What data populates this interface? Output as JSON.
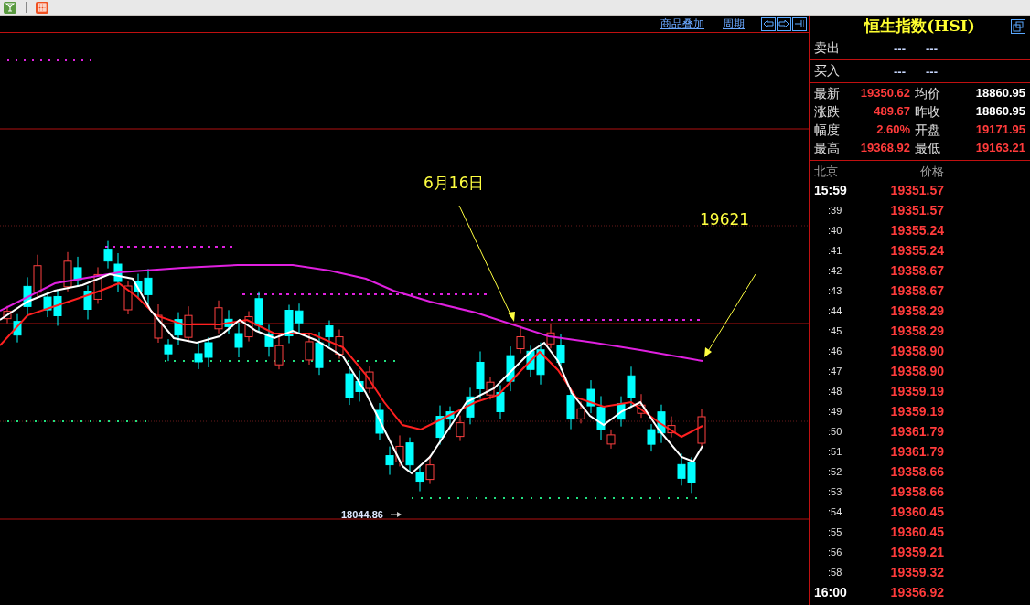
{
  "chart": {
    "links": [
      "商品叠加",
      "周期"
    ],
    "annotations": [
      {
        "text": "6月16日"
      },
      {
        "text": "19621"
      }
    ],
    "low_label": "18044.86"
  },
  "quote": {
    "title": "恒生指数(HSI)",
    "sell": {
      "label": "卖出",
      "values": [
        "---",
        "---"
      ]
    },
    "buy": {
      "label": "买入",
      "values": [
        "---",
        "---"
      ]
    },
    "stats": [
      {
        "label": "最新",
        "value": "19350.62",
        "color": "#ff3b3b"
      },
      {
        "label": "均价",
        "value": "18860.95",
        "color": "#ffffff"
      },
      {
        "label": "涨跌",
        "value": "489.67",
        "color": "#ff3b3b"
      },
      {
        "label": "昨收",
        "value": "18860.95",
        "color": "#ffffff"
      },
      {
        "label": "幅度",
        "value": "2.60%",
        "color": "#ff3b3b"
      },
      {
        "label": "开盘",
        "value": "19171.95",
        "color": "#ff3b3b"
      },
      {
        "label": "最高",
        "value": "19368.92",
        "color": "#ff3b3b"
      },
      {
        "label": "最低",
        "value": "19163.21",
        "color": "#ff3b3b"
      }
    ]
  },
  "ticks": {
    "headers": [
      "北京",
      "价格"
    ],
    "rows": [
      {
        "time": "15:59",
        "price": "19351.57",
        "kind": "hour"
      },
      {
        "time": ":39",
        "price": "19351.57",
        "kind": "minute"
      },
      {
        "time": ":40",
        "price": "19355.24",
        "kind": "minute"
      },
      {
        "time": ":41",
        "price": "19355.24",
        "kind": "minute"
      },
      {
        "time": ":42",
        "price": "19358.67",
        "kind": "minute"
      },
      {
        "time": ":43",
        "price": "19358.67",
        "kind": "minute"
      },
      {
        "time": ":44",
        "price": "19358.29",
        "kind": "minute"
      },
      {
        "time": ":45",
        "price": "19358.29",
        "kind": "minute"
      },
      {
        "time": ":46",
        "price": "19358.90",
        "kind": "minute"
      },
      {
        "time": ":47",
        "price": "19358.90",
        "kind": "minute"
      },
      {
        "time": ":48",
        "price": "19359.19",
        "kind": "minute"
      },
      {
        "time": ":49",
        "price": "19359.19",
        "kind": "minute"
      },
      {
        "time": ":50",
        "price": "19361.79",
        "kind": "minute"
      },
      {
        "time": ":51",
        "price": "19361.79",
        "kind": "minute"
      },
      {
        "time": ":52",
        "price": "19358.66",
        "kind": "minute"
      },
      {
        "time": ":53",
        "price": "19358.66",
        "kind": "minute"
      },
      {
        "time": ":54",
        "price": "19360.45",
        "kind": "minute"
      },
      {
        "time": ":55",
        "price": "19360.45",
        "kind": "minute"
      },
      {
        "time": ":56",
        "price": "19359.21",
        "kind": "minute"
      },
      {
        "time": ":58",
        "price": "19359.32",
        "kind": "minute"
      },
      {
        "time": "16:00",
        "price": "19356.92",
        "kind": "hour"
      }
    ]
  }
}
